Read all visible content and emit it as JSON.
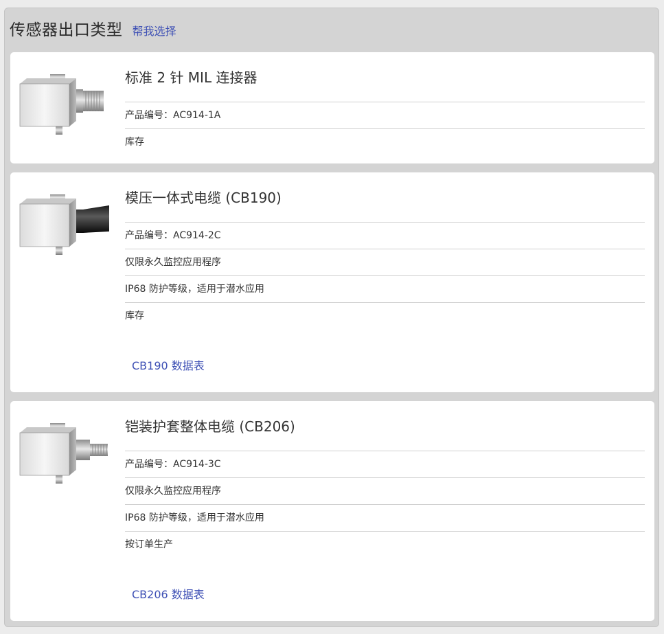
{
  "header": {
    "title": "传感器出口类型",
    "help_link": "帮我选择"
  },
  "products": [
    {
      "title": "标准 2 针 MIL 连接器",
      "part_number": "产品编号：AC914-1A",
      "availability": "库存",
      "connector": "mil-connector"
    },
    {
      "title": "模压一体式电缆 (CB190)",
      "part_number": "产品编号：AC914-2C",
      "note_1": "仅限永久监控应用程序",
      "note_2": "IP68 防护等级，适用于潜水应用",
      "availability": "库存",
      "datasheet": "CB190 数据表",
      "connector": "molded-cable"
    },
    {
      "title": "铠装护套整体电缆 (CB206)",
      "part_number": "产品编号：AC914-3C",
      "note_1": "仅限永久监控应用程序",
      "note_2": "IP68 防护等级，适用于潜水应用",
      "availability": "按订单生产",
      "datasheet": "CB206 数据表",
      "connector": "armored-cable"
    }
  ]
}
